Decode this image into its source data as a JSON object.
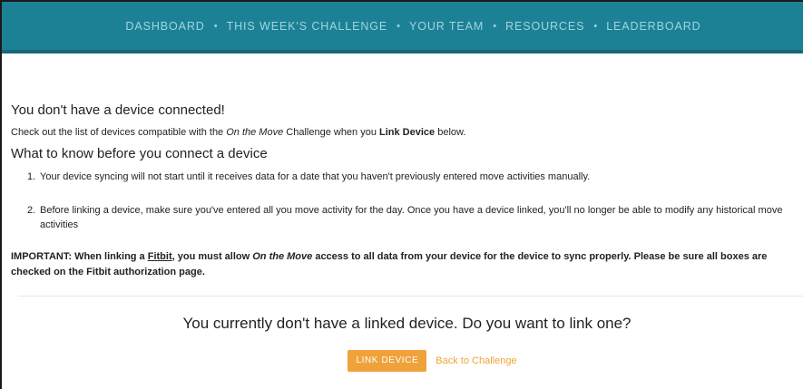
{
  "nav": {
    "items": [
      {
        "label": "DASHBOARD"
      },
      {
        "label": "THIS WEEK'S CHALLENGE"
      },
      {
        "label": "YOUR TEAM"
      },
      {
        "label": "RESOURCES"
      },
      {
        "label": "LEADERBOARD"
      }
    ],
    "separator": "•"
  },
  "main": {
    "heading": "You don't have a device connected!",
    "intro": {
      "part1": "Check out the list of devices compatible with the ",
      "challenge_name": "On the Move",
      "part2": " Challenge when you ",
      "link_device_bold": "Link Device",
      "part3": " below."
    },
    "subheading": "What to know before you connect a device",
    "steps": [
      {
        "num": "1.",
        "text": "Your device syncing will not start until it receives data for a date that you haven't previously entered move activities manually."
      },
      {
        "num": "2.",
        "text": "Before linking a device, make sure you've entered all you move activity for the day. Once you have a device linked, you'll no longer be able to modify any historical move activities"
      }
    ],
    "important": {
      "part1": "IMPORTANT: When linking a ",
      "fitbit_link": "Fitbit",
      "part2": ", you must allow ",
      "app_name": "On the Move",
      "part3": " access to all data from your device for the device to sync properly. Please be sure all boxes are checked on the Fitbit authorization page."
    },
    "cta_question": "You currently don't have a linked device. Do you want to link one?",
    "link_device_button": "LINK DEVICE",
    "back_link": "Back to Challenge"
  },
  "colors": {
    "nav_bg": "#1d8196",
    "nav_text": "#9fd4df",
    "accent": "#f0a23a"
  }
}
